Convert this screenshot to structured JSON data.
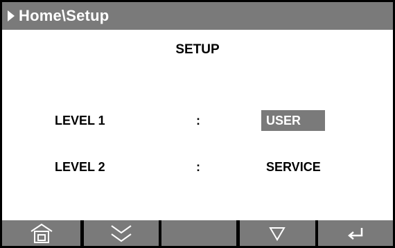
{
  "header": {
    "breadcrumb": "Home\\Setup",
    "icon": "play-right-icon"
  },
  "main": {
    "title": "SETUP",
    "rows": [
      {
        "label": "LEVEL 1",
        "separator": ":",
        "value": "USER",
        "selected": true
      },
      {
        "label": "LEVEL 2",
        "separator": ":",
        "value": "SERVICE",
        "selected": false
      }
    ]
  },
  "softkeys": [
    {
      "icon": "home-icon"
    },
    {
      "icon": "double-chevron-down-icon"
    },
    {
      "icon": ""
    },
    {
      "icon": "triangle-down-icon"
    },
    {
      "icon": "enter-icon"
    }
  ],
  "colors": {
    "bar": "#7a7a7a",
    "background": "#ffffff",
    "text": "#000000",
    "selected_text": "#ffffff"
  }
}
